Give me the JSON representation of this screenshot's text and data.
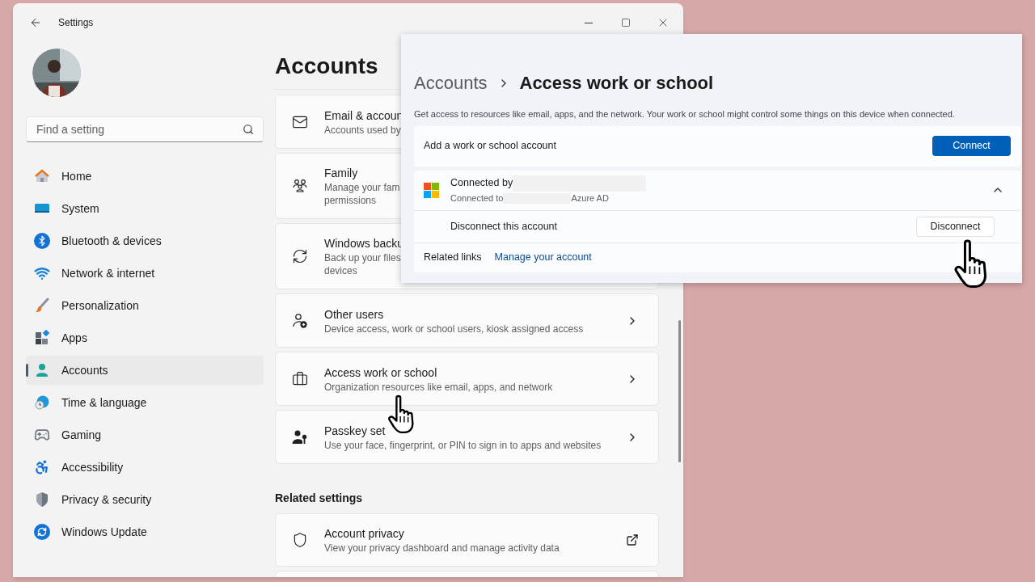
{
  "window": {
    "title": "Settings"
  },
  "sidebar": {
    "search": {
      "placeholder": "Find a setting"
    },
    "items": [
      {
        "label": "Home",
        "selected": false
      },
      {
        "label": "System",
        "selected": false
      },
      {
        "label": "Bluetooth & devices",
        "selected": false
      },
      {
        "label": "Network & internet",
        "selected": false
      },
      {
        "label": "Personalization",
        "selected": false
      },
      {
        "label": "Apps",
        "selected": false
      },
      {
        "label": "Accounts",
        "selected": true
      },
      {
        "label": "Time & language",
        "selected": false
      },
      {
        "label": "Gaming",
        "selected": false
      },
      {
        "label": "Accessibility",
        "selected": false
      },
      {
        "label": "Privacy & security",
        "selected": false
      },
      {
        "label": "Windows Update",
        "selected": false
      }
    ]
  },
  "page": {
    "title": "Accounts",
    "cards": [
      {
        "title": "Email & accoun",
        "subtitle": "Accounts used by",
        "kind": "plain"
      },
      {
        "title": "Family",
        "subtitle": "Manage your fam",
        "subtitle_2": "permissions",
        "kind": "plain"
      },
      {
        "title": "Windows backu",
        "subtitle": "Back up your files",
        "subtitle_2": "devices",
        "kind": "plain"
      },
      {
        "title": "Other users",
        "subtitle": "Device access, work or school users, kiosk assigned access",
        "kind": "chevron"
      },
      {
        "title": "Access work or school",
        "subtitle": "Organization resources like email, apps, and network",
        "kind": "chevron"
      },
      {
        "title": "Passkey set",
        "subtitle": "Use your face, fingerprint, or PIN to sign in to apps and websites",
        "kind": "chevron"
      }
    ],
    "related_heading": "Related settings",
    "related": [
      {
        "title": "Account privacy",
        "subtitle": "View your privacy dashboard and manage activity data",
        "kind": "external"
      }
    ]
  },
  "overlay": {
    "breadcrumb": {
      "parent": "Accounts",
      "current": "Access work or school"
    },
    "description": "Get access to resources like email, apps, and the network. Your work or school might control some things on this device when connected.",
    "add_row": {
      "label": "Add a work or school account",
      "button": "Connect"
    },
    "account": {
      "title": "Connected by",
      "subtitle": "Connected to",
      "provider": "Azure AD",
      "expanded": true
    },
    "action_row": {
      "label": "Disconnect this account",
      "button": "Disconnect"
    },
    "related": {
      "label": "Related links",
      "link": "Manage your account"
    }
  }
}
